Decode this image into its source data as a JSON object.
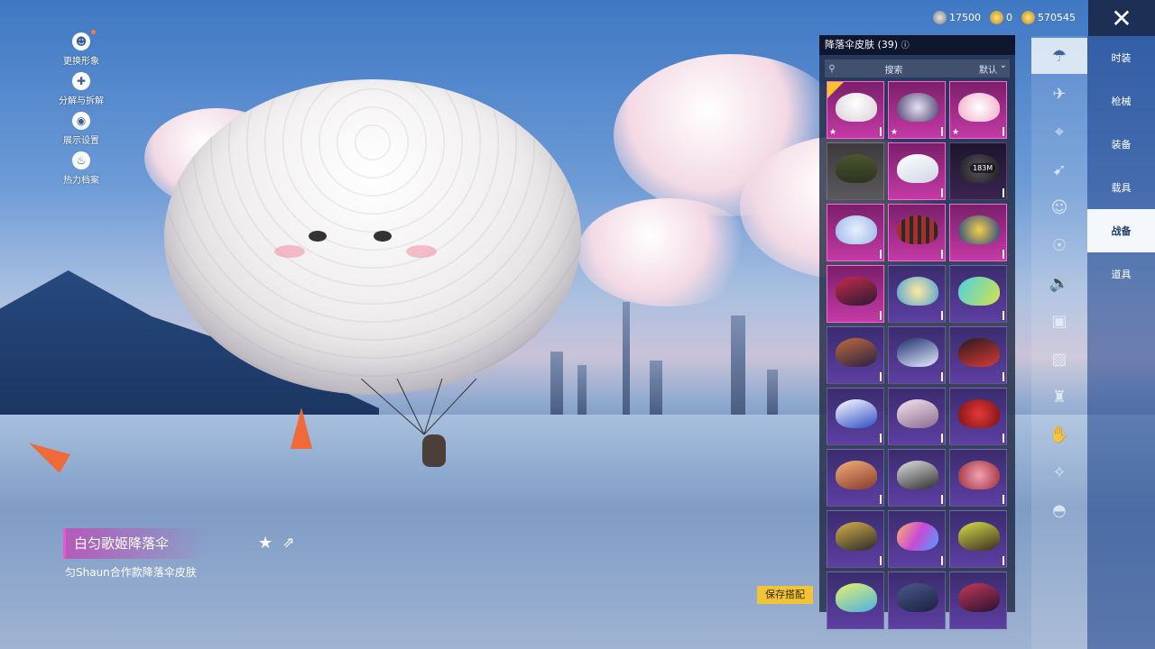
{
  "left_menu": [
    {
      "label": "更换形象",
      "icon": "avatar-icon"
    },
    {
      "label": "分解与拆解",
      "icon": "puzzle-icon"
    },
    {
      "label": "展示设置",
      "icon": "eye-icon"
    },
    {
      "label": "热力档案",
      "icon": "flame-icon"
    }
  ],
  "currency": [
    {
      "value": "17500",
      "icon": "silver-coin-icon"
    },
    {
      "value": "0",
      "icon": "ag-coin-icon"
    },
    {
      "value": "570545",
      "icon": "gold-coin-icon"
    }
  ],
  "panel": {
    "title": "降落伞皮肤 (39)",
    "search_placeholder": "搜索",
    "sort_label": "默认"
  },
  "download_label": "183M",
  "right_nav": [
    {
      "label": "时装",
      "active": false
    },
    {
      "label": "枪械",
      "active": false
    },
    {
      "label": "装备",
      "active": false
    },
    {
      "label": "载具",
      "active": false
    },
    {
      "label": "战备",
      "active": true
    },
    {
      "label": "道具",
      "active": false
    }
  ],
  "item": {
    "name": "白匀歌姬降落伞",
    "description": "匀Shaun合作款降落伞皮肤"
  },
  "save_label": "保存搭配",
  "colors": {
    "accent": "#f1c433",
    "rarity_pink": "#c43aa6",
    "rarity_purple": "#5d3fa2"
  }
}
